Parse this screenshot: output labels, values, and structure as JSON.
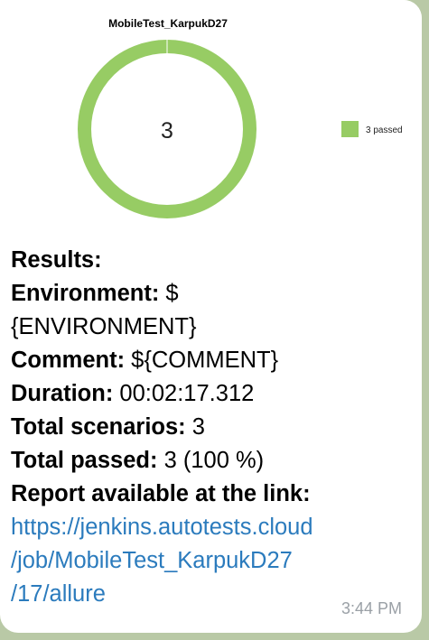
{
  "chart_data": {
    "type": "pie",
    "title": "MobileTest_KarpukD27",
    "center_label": "3",
    "slices": [
      {
        "name": "3 passed",
        "value": 3,
        "color": "#97cc64"
      }
    ],
    "legend": {
      "position": "right",
      "entries": [
        "3 passed"
      ]
    }
  },
  "message": {
    "results_label": "Results:",
    "environment_key": "Environment:",
    "environment_value_1": " $",
    "environment_value_2": "{ENVIRONMENT}",
    "comment_key": "Comment:",
    "comment_value": " ${COMMENT}",
    "duration_key": "Duration:",
    "duration_value": " 00:02:17.312",
    "total_scenarios_key": "Total scenarios:",
    "total_scenarios_value": " 3",
    "total_passed_key": "Total passed:",
    "total_passed_value": " 3 (100 %)",
    "report_label": "Report available at the link:",
    "link_line_1": "https://jenkins.autotests.cloud",
    "link_line_2": "/job/MobileTest_KarpukD27",
    "link_line_3": "/17/allure"
  },
  "time": "3:44 PM"
}
